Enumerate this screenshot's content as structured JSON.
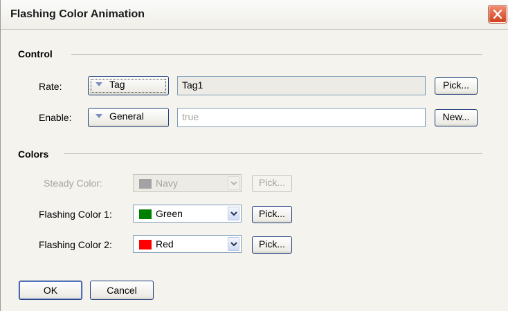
{
  "window": {
    "title": "Flashing Color Animation",
    "close_icon": "close-icon"
  },
  "control": {
    "section_label": "Control",
    "rate": {
      "label": "Rate:",
      "type_button": "Tag",
      "value": "Tag1",
      "action_button": "Pick..."
    },
    "enable": {
      "label": "Enable:",
      "type_button": "General",
      "value": "true",
      "action_button": "New..."
    }
  },
  "colors": {
    "section_label": "Colors",
    "steady": {
      "label": "Steady Color:",
      "color_name": "Navy",
      "swatch_color": "#a3a3a3",
      "pick_button": "Pick...",
      "disabled": true
    },
    "flashing1": {
      "label": "Flashing Color 1:",
      "color_name": "Green",
      "swatch_color": "#008000",
      "pick_button": "Pick..."
    },
    "flashing2": {
      "label": "Flashing Color 2:",
      "color_name": "Red",
      "swatch_color": "#ff0000",
      "pick_button": "Pick..."
    }
  },
  "footer": {
    "ok_button": "OK",
    "cancel_button": "Cancel"
  }
}
